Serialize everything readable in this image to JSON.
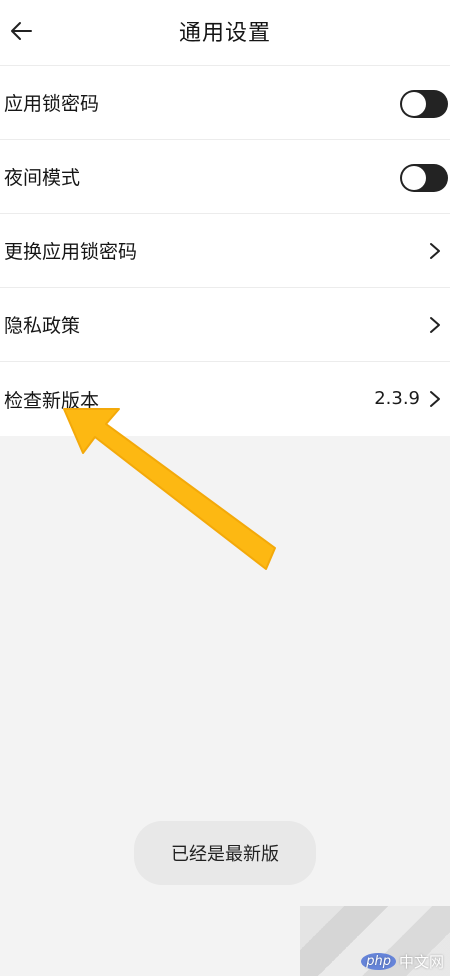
{
  "header": {
    "title": "通用设置",
    "back_icon": "arrow-left-icon"
  },
  "settings": [
    {
      "label": "应用锁密码",
      "control": "toggle",
      "on": false
    },
    {
      "label": "夜间模式",
      "control": "toggle",
      "on": false
    },
    {
      "label": "更换应用锁密码",
      "control": "chevron"
    },
    {
      "label": "隐私政策",
      "control": "chevron"
    },
    {
      "label": "检查新版本",
      "control": "chevron",
      "value": "2.3.9"
    }
  ],
  "toast": {
    "message": "已经是最新版"
  },
  "annotation": {
    "icon": "yellow-arrow-icon",
    "color": "#FDB812"
  },
  "watermark": {
    "logo": "php",
    "text": "中文网"
  },
  "colors": {
    "background": "#f3f3f3",
    "surface": "#ffffff",
    "toggle_off": "#232323"
  }
}
